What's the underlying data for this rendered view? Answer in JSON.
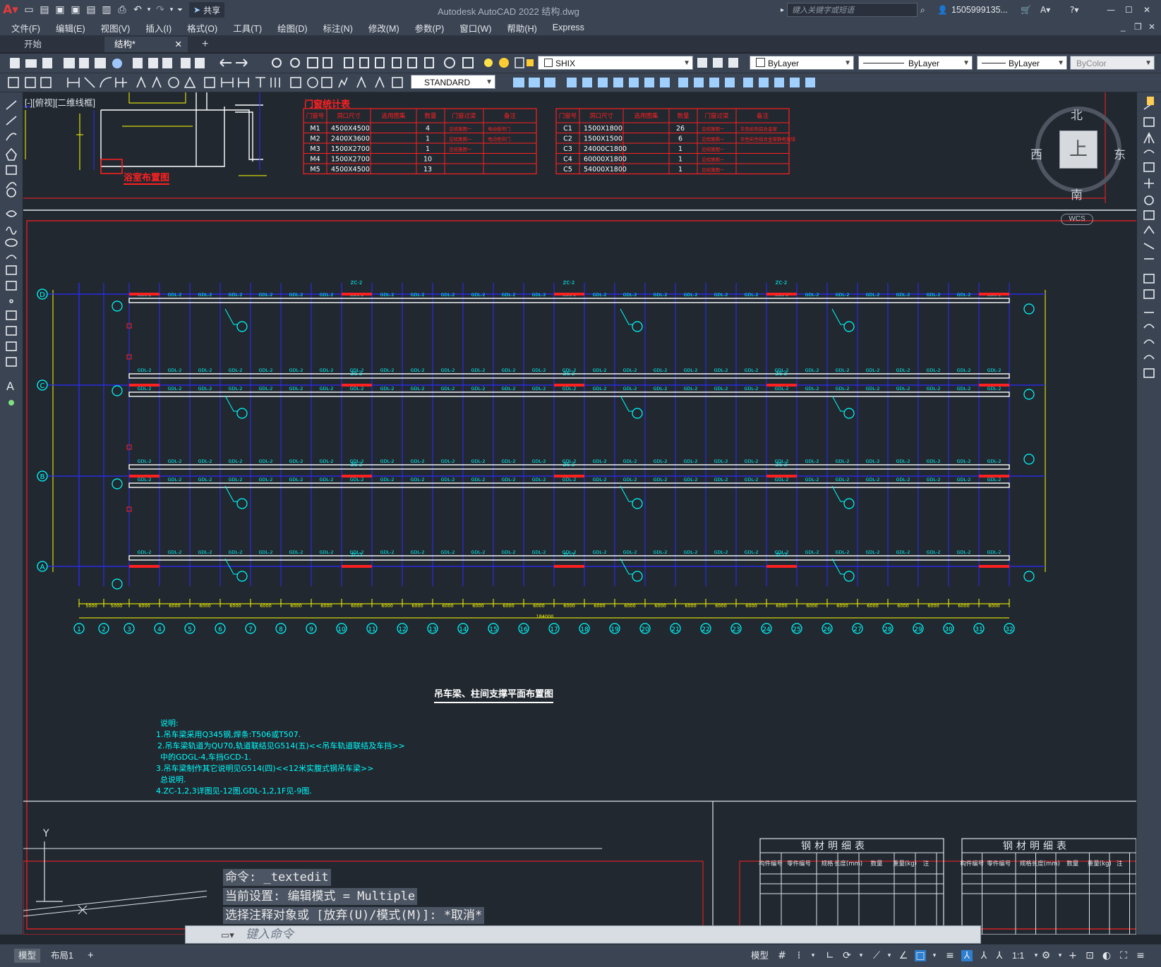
{
  "window": {
    "title": "Autodesk AutoCAD 2022    结构.dwg",
    "share_label": "共享",
    "search_placeholder": "键入关键字或短语",
    "user": "1505999135..."
  },
  "menu": [
    "文件(F)",
    "编辑(E)",
    "视图(V)",
    "插入(I)",
    "格式(O)",
    "工具(T)",
    "绘图(D)",
    "标注(N)",
    "修改(M)",
    "参数(P)",
    "窗口(W)",
    "帮助(H)",
    "Express"
  ],
  "file_tabs": {
    "start": "开始",
    "active": "结构*"
  },
  "toolbar": {
    "textstyle": "SHIX",
    "dimstyle": "STANDARD",
    "layer_color": "ByLayer",
    "linetype": "ByLayer",
    "lineweight": "ByLayer",
    "plotstyle": "ByColor"
  },
  "viewport_label": "[-][俯视][二维线框]",
  "viewcube": {
    "north": "北",
    "south": "南",
    "east": "东",
    "west": "西",
    "top": "上",
    "wcs": "WCS"
  },
  "drawing": {
    "door_table_title": "门窗统计表",
    "bath_plan_title": "浴室布置图",
    "door_headers": [
      "门窗号",
      "洞口尺寸",
      "选用图集",
      "数量",
      "门窗过梁",
      "备注"
    ],
    "doors": [
      [
        "M1",
        "4500X4500",
        "",
        "4",
        "见结施图一",
        "电动卷帘门"
      ],
      [
        "M2",
        "2400X3600",
        "",
        "1",
        "见结施图一",
        "电动卷帘门"
      ],
      [
        "M3",
        "1500X2700",
        "",
        "1",
        "见结施图一",
        ""
      ],
      [
        "M4",
        "1500X2700",
        "",
        "10",
        "",
        ""
      ],
      [
        "M5",
        "4500X4500",
        "",
        "13",
        "",
        ""
      ]
    ],
    "windows": [
      [
        "C1",
        "1500X1800",
        "",
        "26",
        "见结施图一",
        "灰色彩色铝合金窗"
      ],
      [
        "C2",
        "1500X1500",
        "",
        "6",
        "见结施图一",
        "灰色彩色铝合金窗静电玻璃"
      ],
      [
        "C3",
        "24000C1800",
        "",
        "1",
        "见结施图一",
        ""
      ],
      [
        "C4",
        "60000X1800",
        "",
        "1",
        "见结施图一",
        ""
      ],
      [
        "C5",
        "54000X1800",
        "",
        "1",
        "见结施图一",
        ""
      ]
    ],
    "plan_title": "吊车梁、柱间支撑平面布置图",
    "row_axes": [
      "D",
      "C",
      "B",
      "A"
    ],
    "col_axes": [
      "1",
      "2",
      "3",
      "4",
      "5",
      "6",
      "7",
      "8",
      "9",
      "10",
      "11",
      "12",
      "13",
      "14",
      "15",
      "16",
      "17",
      "18",
      "19",
      "20",
      "21",
      "22",
      "23",
      "24",
      "25",
      "26",
      "27",
      "28",
      "29",
      "30",
      "31",
      "32"
    ],
    "beam_label": "GDL-2",
    "brace_label": "ZC-2",
    "bay_dims": [
      "5000",
      "5000",
      "6000",
      "6000",
      "6000",
      "6000",
      "6000",
      "6000",
      "6000",
      "6000",
      "6000",
      "6000",
      "6000",
      "6000",
      "6000",
      "6000",
      "6000",
      "6000",
      "6000",
      "6000",
      "6000",
      "6000",
      "6000",
      "6000",
      "6000",
      "6000",
      "6000",
      "6000",
      "6000",
      "6000",
      "6000"
    ],
    "total_dim": "184000",
    "notes_title": "说明:",
    "notes": [
      "1.吊车梁采用Q345钢,焊条:T506或T507.",
      "2.吊车梁轨道为QU70,轨道联结见G514(五)<<吊车轨道联结及车挡>>",
      "中的GDGL-4,车挡GCD-1.",
      "3.吊车梁制作其它说明见G514(四)<<12米实腹式钢吊车梁>>",
      "总说明.",
      "4.ZC-1,2,3详图见-12图,GDL-1,2,1F见-9图."
    ],
    "steel_table_title": "钢材明细表",
    "steel_headers": [
      "构件编号",
      "零件编号",
      "规格",
      "长度(mm)",
      "数量",
      "重量(kg)",
      "注"
    ]
  },
  "command": {
    "line1": "命令: _textedit",
    "line2": "当前设置: 编辑模式 = Multiple",
    "line3": "选择注释对象或 [放弃(U)/模式(M)]: *取消*",
    "input_placeholder": "键入命令"
  },
  "status": {
    "layout_tabs": [
      "模型",
      "布局1"
    ],
    "model_label": "模型",
    "scale": "1:1"
  },
  "colors": {
    "title_bg": "#3b4453",
    "canvas_bg": "#212830",
    "cad_blue": "#2a2cff",
    "cad_cyan": "#00ffff",
    "cad_red": "#ff2020",
    "cad_yellow": "#ffff00",
    "cad_white": "#ffffff"
  }
}
